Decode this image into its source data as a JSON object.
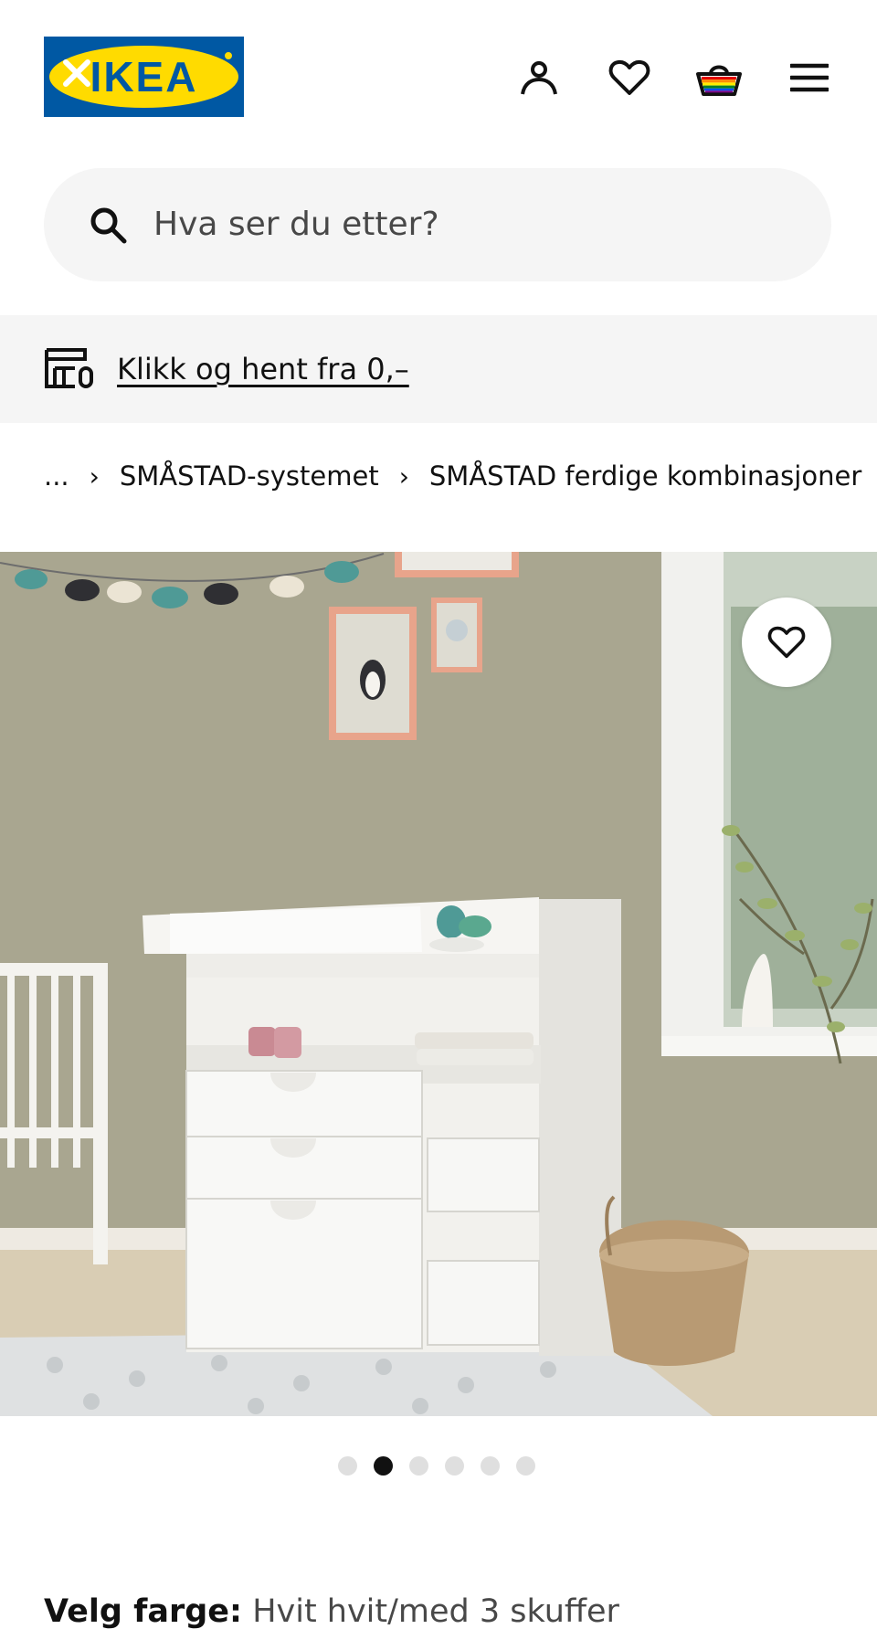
{
  "header": {
    "logo_text": "IKEA",
    "icons": [
      "profile-icon",
      "heart-icon",
      "basket-icon",
      "menu-icon"
    ]
  },
  "search": {
    "placeholder": "Hva ser du etter?"
  },
  "promo": {
    "link_text": "Klikk og hent fra 0,–",
    "icon": "store-pickup-icon"
  },
  "breadcrumb": {
    "ellipsis": "...",
    "items": [
      "SMÅSTAD-systemet",
      "SMÅSTAD ferdige kombinasjoner"
    ]
  },
  "product": {
    "image_alt": "SMÅSTAD stellebord med skuffer i barnerom",
    "favorite_icon": "heart-icon",
    "carousel": {
      "total": 6,
      "active": 2
    }
  },
  "color": {
    "label": "Velg farge:",
    "value": "Hvit hvit/med 3 skuffer"
  },
  "colors": {
    "ikea_blue": "#0058a3",
    "ikea_yellow": "#ffdb00",
    "background_gray": "#f5f5f5",
    "text": "#111111"
  }
}
